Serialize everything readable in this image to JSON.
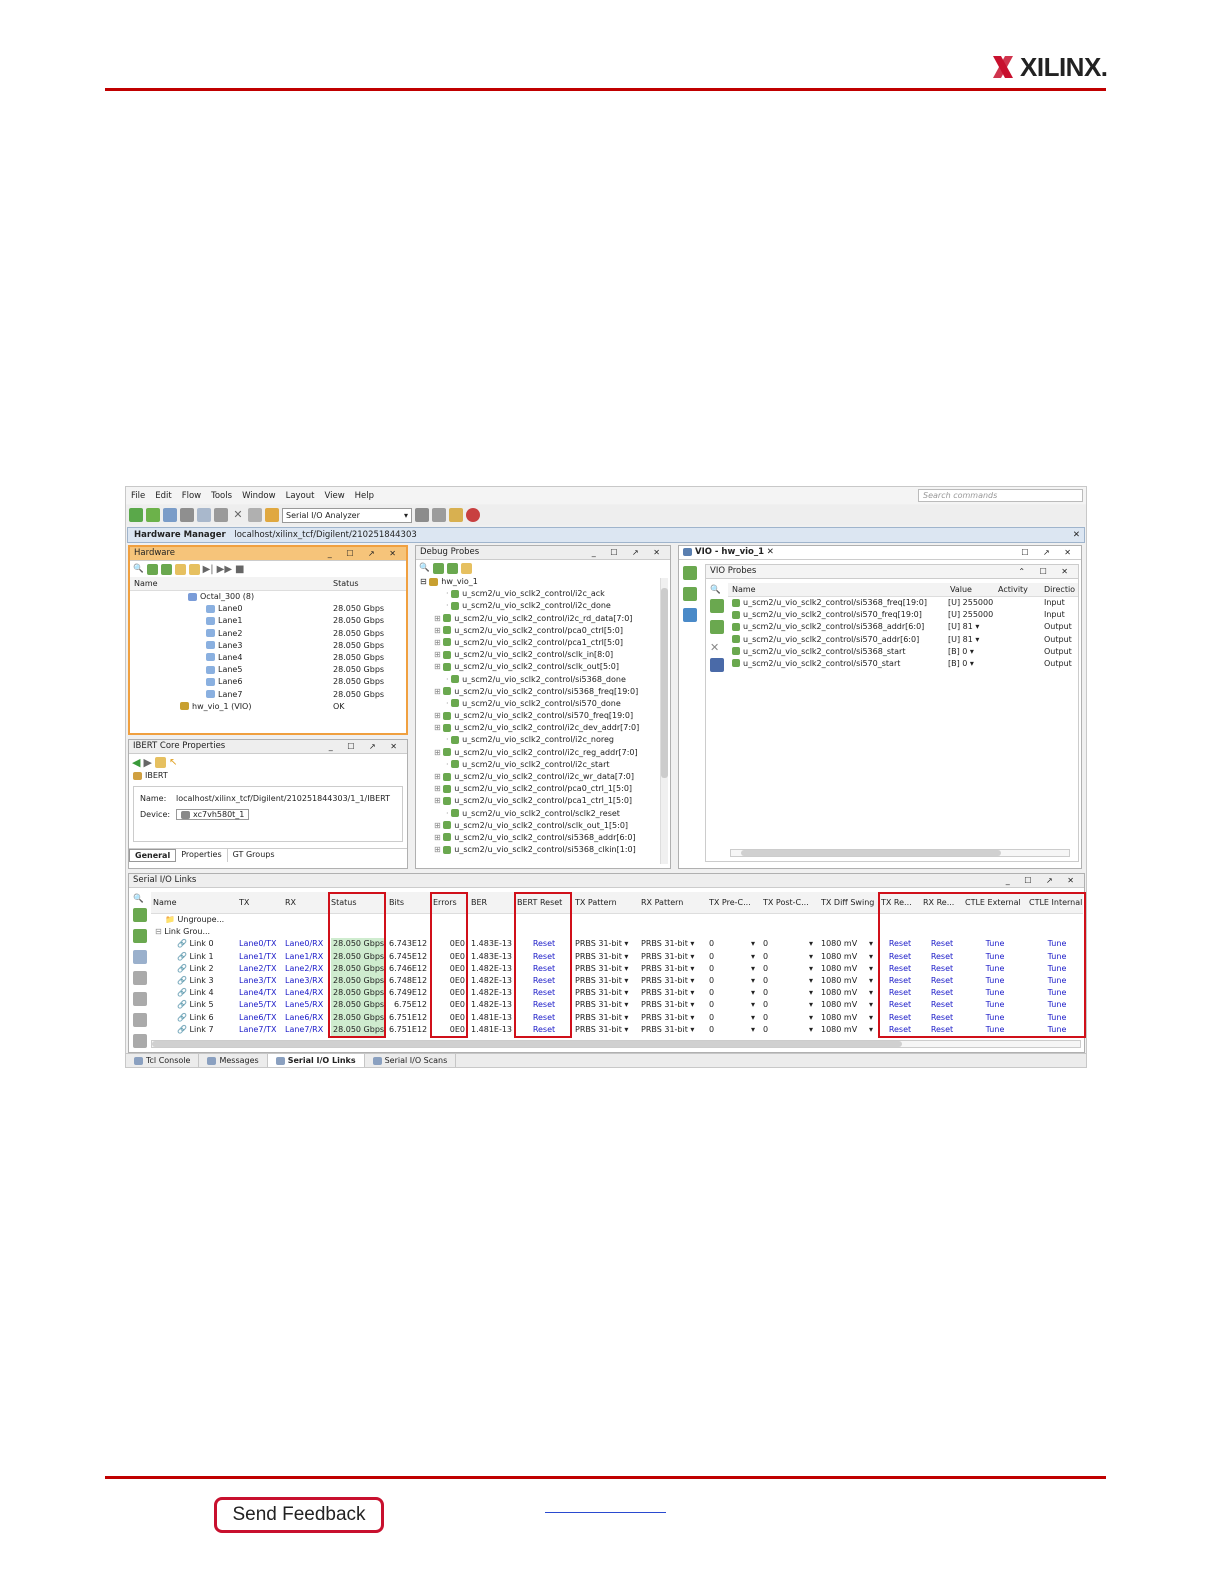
{
  "brand": {
    "name": "XILINX."
  },
  "feedback": {
    "label": "Send Feedback"
  },
  "menu": [
    "File",
    "Edit",
    "Flow",
    "Tools",
    "Window",
    "Layout",
    "View",
    "Help"
  ],
  "search_placeholder": "Search commands",
  "toolbar": {
    "layout_select": "Serial I/O Analyzer"
  },
  "hw_manager": {
    "title": "Hardware Manager",
    "path": "localhost/xilinx_tcf/Digilent/210251844303"
  },
  "hardware": {
    "title": "Hardware",
    "columns": [
      "Name",
      "Status"
    ],
    "rows": [
      {
        "name": "Octal_300 (8)",
        "status": ""
      },
      {
        "name": "Lane0",
        "status": "28.050 Gbps"
      },
      {
        "name": "Lane1",
        "status": "28.050 Gbps"
      },
      {
        "name": "Lane2",
        "status": "28.050 Gbps"
      },
      {
        "name": "Lane3",
        "status": "28.050 Gbps"
      },
      {
        "name": "Lane4",
        "status": "28.050 Gbps"
      },
      {
        "name": "Lane5",
        "status": "28.050 Gbps"
      },
      {
        "name": "Lane6",
        "status": "28.050 Gbps"
      },
      {
        "name": "Lane7",
        "status": "28.050 Gbps"
      },
      {
        "name": "hw_vio_1 (VIO)",
        "status": "OK"
      }
    ]
  },
  "ibert": {
    "title": "IBERT Core Properties",
    "core": "IBERT",
    "name_label": "Name:",
    "name": "localhost/xilinx_tcf/Digilent/210251844303/1_1/IBERT",
    "device_label": "Device:",
    "device": "xc7vh580t_1",
    "tabs": [
      "General",
      "Properties",
      "GT Groups"
    ]
  },
  "debug": {
    "title": "Debug Probes",
    "root": "hw_vio_1",
    "probes": [
      "u_scm2/u_vio_sclk2_control/i2c_ack",
      "u_scm2/u_vio_sclk2_control/i2c_done",
      "u_scm2/u_vio_sclk2_control/i2c_rd_data[7:0]",
      "u_scm2/u_vio_sclk2_control/pca0_ctrl[5:0]",
      "u_scm2/u_vio_sclk2_control/pca1_ctrl[5:0]",
      "u_scm2/u_vio_sclk2_control/sclk_in[8:0]",
      "u_scm2/u_vio_sclk2_control/sclk_out[5:0]",
      "u_scm2/u_vio_sclk2_control/si5368_done",
      "u_scm2/u_vio_sclk2_control/si5368_freq[19:0]",
      "u_scm2/u_vio_sclk2_control/si570_done",
      "u_scm2/u_vio_sclk2_control/si570_freq[19:0]",
      "u_scm2/u_vio_sclk2_control/i2c_dev_addr[7:0]",
      "u_scm2/u_vio_sclk2_control/i2c_noreg",
      "u_scm2/u_vio_sclk2_control/i2c_reg_addr[7:0]",
      "u_scm2/u_vio_sclk2_control/i2c_start",
      "u_scm2/u_vio_sclk2_control/i2c_wr_data[7:0]",
      "u_scm2/u_vio_sclk2_control/pca0_ctrl_1[5:0]",
      "u_scm2/u_vio_sclk2_control/pca1_ctrl_1[5:0]",
      "u_scm2/u_vio_sclk2_control/sclk2_reset",
      "u_scm2/u_vio_sclk2_control/sclk_out_1[5:0]",
      "u_scm2/u_vio_sclk2_control/si5368_addr[6:0]",
      "u_scm2/u_vio_sclk2_control/si5368_clkin[1:0]"
    ]
  },
  "vio": {
    "tab": "VIO - hw_vio_1",
    "title": "VIO Probes",
    "columns": [
      "Name",
      "Value",
      "Activity",
      "Directio"
    ],
    "rows": [
      {
        "name": "u_scm2/u_vio_sclk2_control/si5368_freq[19:0]",
        "value": "[U] 255000",
        "dir": "Input"
      },
      {
        "name": "u_scm2/u_vio_sclk2_control/si570_freq[19:0]",
        "value": "[U] 255000",
        "dir": "Input"
      },
      {
        "name": "u_scm2/u_vio_sclk2_control/si5368_addr[6:0]",
        "value": "[U] 81",
        "dir": "Output"
      },
      {
        "name": "u_scm2/u_vio_sclk2_control/si570_addr[6:0]",
        "value": "[U] 81",
        "dir": "Output"
      },
      {
        "name": "u_scm2/u_vio_sclk2_control/si5368_start",
        "value": "[B] 0",
        "dir": "Output"
      },
      {
        "name": "u_scm2/u_vio_sclk2_control/si570_start",
        "value": "[B] 0",
        "dir": "Output"
      }
    ]
  },
  "sio": {
    "title": "Serial I/O Links",
    "columns": [
      "Name",
      "TX",
      "RX",
      "Status",
      "Bits",
      "Errors",
      "BER",
      "BERT Reset",
      "TX Pattern",
      "RX Pattern",
      "TX Pre-C...",
      "TX Post-C...",
      "TX Diff Swing",
      "TX Re...",
      "RX Re...",
      "CTLE External",
      "CTLE Internal"
    ],
    "groups": [
      "Ungroupe...",
      "Link Grou..."
    ],
    "links": [
      {
        "name": "Link 0",
        "tx": "Lane0/TX",
        "rx": "Lane0/RX",
        "status": "28.050 Gbps",
        "bits": "6.743E12",
        "errors": "0E0",
        "ber": "1.483E-13"
      },
      {
        "name": "Link 1",
        "tx": "Lane1/TX",
        "rx": "Lane1/RX",
        "status": "28.050 Gbps",
        "bits": "6.745E12",
        "errors": "0E0",
        "ber": "1.483E-13"
      },
      {
        "name": "Link 2",
        "tx": "Lane2/TX",
        "rx": "Lane2/RX",
        "status": "28.050 Gbps",
        "bits": "6.746E12",
        "errors": "0E0",
        "ber": "1.482E-13"
      },
      {
        "name": "Link 3",
        "tx": "Lane3/TX",
        "rx": "Lane3/RX",
        "status": "28.050 Gbps",
        "bits": "6.748E12",
        "errors": "0E0",
        "ber": "1.482E-13"
      },
      {
        "name": "Link 4",
        "tx": "Lane4/TX",
        "rx": "Lane4/RX",
        "status": "28.050 Gbps",
        "bits": "6.749E12",
        "errors": "0E0",
        "ber": "1.482E-13"
      },
      {
        "name": "Link 5",
        "tx": "Lane5/TX",
        "rx": "Lane5/RX",
        "status": "28.050 Gbps",
        "bits": "6.75E12",
        "errors": "0E0",
        "ber": "1.482E-13"
      },
      {
        "name": "Link 6",
        "tx": "Lane6/TX",
        "rx": "Lane6/RX",
        "status": "28.050 Gbps",
        "bits": "6.751E12",
        "errors": "0E0",
        "ber": "1.481E-13"
      },
      {
        "name": "Link 7",
        "tx": "Lane7/TX",
        "rx": "Lane7/RX",
        "status": "28.050 Gbps",
        "bits": "6.751E12",
        "errors": "0E0",
        "ber": "1.481E-13"
      }
    ],
    "reset_label": "Reset",
    "tune_label": "Tune",
    "pattern": "PRBS 31-bit",
    "pre": "0",
    "post": "0",
    "swing": "1080 mV"
  },
  "bottom_tabs": [
    "Tcl Console",
    "Messages",
    "Serial I/O Links",
    "Serial I/O Scans"
  ]
}
